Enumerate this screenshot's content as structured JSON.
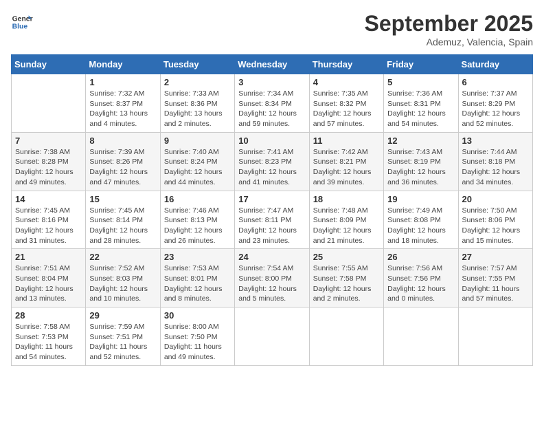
{
  "logo": {
    "line1": "General",
    "line2": "Blue"
  },
  "title": "September 2025",
  "location": "Ademuz, Valencia, Spain",
  "weekdays": [
    "Sunday",
    "Monday",
    "Tuesday",
    "Wednesday",
    "Thursday",
    "Friday",
    "Saturday"
  ],
  "weeks": [
    [
      null,
      {
        "day": 1,
        "sunrise": "7:32 AM",
        "sunset": "8:37 PM",
        "daylight": "13 hours and 4 minutes."
      },
      {
        "day": 2,
        "sunrise": "7:33 AM",
        "sunset": "8:36 PM",
        "daylight": "13 hours and 2 minutes."
      },
      {
        "day": 3,
        "sunrise": "7:34 AM",
        "sunset": "8:34 PM",
        "daylight": "12 hours and 59 minutes."
      },
      {
        "day": 4,
        "sunrise": "7:35 AM",
        "sunset": "8:32 PM",
        "daylight": "12 hours and 57 minutes."
      },
      {
        "day": 5,
        "sunrise": "7:36 AM",
        "sunset": "8:31 PM",
        "daylight": "12 hours and 54 minutes."
      },
      {
        "day": 6,
        "sunrise": "7:37 AM",
        "sunset": "8:29 PM",
        "daylight": "12 hours and 52 minutes."
      }
    ],
    [
      {
        "day": 7,
        "sunrise": "7:38 AM",
        "sunset": "8:28 PM",
        "daylight": "12 hours and 49 minutes."
      },
      {
        "day": 8,
        "sunrise": "7:39 AM",
        "sunset": "8:26 PM",
        "daylight": "12 hours and 47 minutes."
      },
      {
        "day": 9,
        "sunrise": "7:40 AM",
        "sunset": "8:24 PM",
        "daylight": "12 hours and 44 minutes."
      },
      {
        "day": 10,
        "sunrise": "7:41 AM",
        "sunset": "8:23 PM",
        "daylight": "12 hours and 41 minutes."
      },
      {
        "day": 11,
        "sunrise": "7:42 AM",
        "sunset": "8:21 PM",
        "daylight": "12 hours and 39 minutes."
      },
      {
        "day": 12,
        "sunrise": "7:43 AM",
        "sunset": "8:19 PM",
        "daylight": "12 hours and 36 minutes."
      },
      {
        "day": 13,
        "sunrise": "7:44 AM",
        "sunset": "8:18 PM",
        "daylight": "12 hours and 34 minutes."
      }
    ],
    [
      {
        "day": 14,
        "sunrise": "7:45 AM",
        "sunset": "8:16 PM",
        "daylight": "12 hours and 31 minutes."
      },
      {
        "day": 15,
        "sunrise": "7:45 AM",
        "sunset": "8:14 PM",
        "daylight": "12 hours and 28 minutes."
      },
      {
        "day": 16,
        "sunrise": "7:46 AM",
        "sunset": "8:13 PM",
        "daylight": "12 hours and 26 minutes."
      },
      {
        "day": 17,
        "sunrise": "7:47 AM",
        "sunset": "8:11 PM",
        "daylight": "12 hours and 23 minutes."
      },
      {
        "day": 18,
        "sunrise": "7:48 AM",
        "sunset": "8:09 PM",
        "daylight": "12 hours and 21 minutes."
      },
      {
        "day": 19,
        "sunrise": "7:49 AM",
        "sunset": "8:08 PM",
        "daylight": "12 hours and 18 minutes."
      },
      {
        "day": 20,
        "sunrise": "7:50 AM",
        "sunset": "8:06 PM",
        "daylight": "12 hours and 15 minutes."
      }
    ],
    [
      {
        "day": 21,
        "sunrise": "7:51 AM",
        "sunset": "8:04 PM",
        "daylight": "12 hours and 13 minutes."
      },
      {
        "day": 22,
        "sunrise": "7:52 AM",
        "sunset": "8:03 PM",
        "daylight": "12 hours and 10 minutes."
      },
      {
        "day": 23,
        "sunrise": "7:53 AM",
        "sunset": "8:01 PM",
        "daylight": "12 hours and 8 minutes."
      },
      {
        "day": 24,
        "sunrise": "7:54 AM",
        "sunset": "8:00 PM",
        "daylight": "12 hours and 5 minutes."
      },
      {
        "day": 25,
        "sunrise": "7:55 AM",
        "sunset": "7:58 PM",
        "daylight": "12 hours and 2 minutes."
      },
      {
        "day": 26,
        "sunrise": "7:56 AM",
        "sunset": "7:56 PM",
        "daylight": "12 hours and 0 minutes."
      },
      {
        "day": 27,
        "sunrise": "7:57 AM",
        "sunset": "7:55 PM",
        "daylight": "11 hours and 57 minutes."
      }
    ],
    [
      {
        "day": 28,
        "sunrise": "7:58 AM",
        "sunset": "7:53 PM",
        "daylight": "11 hours and 54 minutes."
      },
      {
        "day": 29,
        "sunrise": "7:59 AM",
        "sunset": "7:51 PM",
        "daylight": "11 hours and 52 minutes."
      },
      {
        "day": 30,
        "sunrise": "8:00 AM",
        "sunset": "7:50 PM",
        "daylight": "11 hours and 49 minutes."
      },
      null,
      null,
      null,
      null
    ]
  ]
}
